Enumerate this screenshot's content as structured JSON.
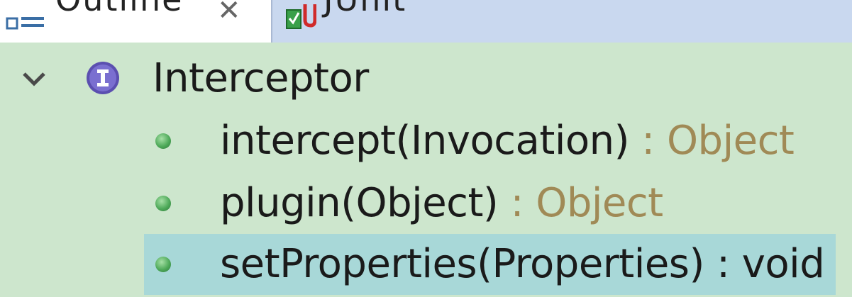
{
  "tabs": {
    "outline": {
      "label": "Outline",
      "icon": "outline-icon",
      "close": "✕"
    },
    "junit": {
      "label": "JUnit",
      "icon": "junit-icon"
    }
  },
  "tree": {
    "root": {
      "label": "Interceptor",
      "icon": "interface-icon",
      "expanded": true
    },
    "methods": [
      {
        "name": "intercept(Invocation)",
        "sep": " : ",
        "type": "Object",
        "icon": "public-method-icon",
        "selected": false
      },
      {
        "name": "plugin(Object)",
        "sep": " : ",
        "type": "Object",
        "icon": "public-method-icon",
        "selected": false
      },
      {
        "name": "setProperties(Properties)",
        "sep": " : ",
        "type": "void",
        "icon": "public-method-icon",
        "selected": true
      }
    ]
  },
  "colors": {
    "tree_bg": "#cde6cd",
    "selection_bg": "#a8d8d8",
    "junit_tab_bg": "#c9d8ef",
    "return_type": "#a08a56",
    "interface_icon": "#5b4fb0"
  }
}
